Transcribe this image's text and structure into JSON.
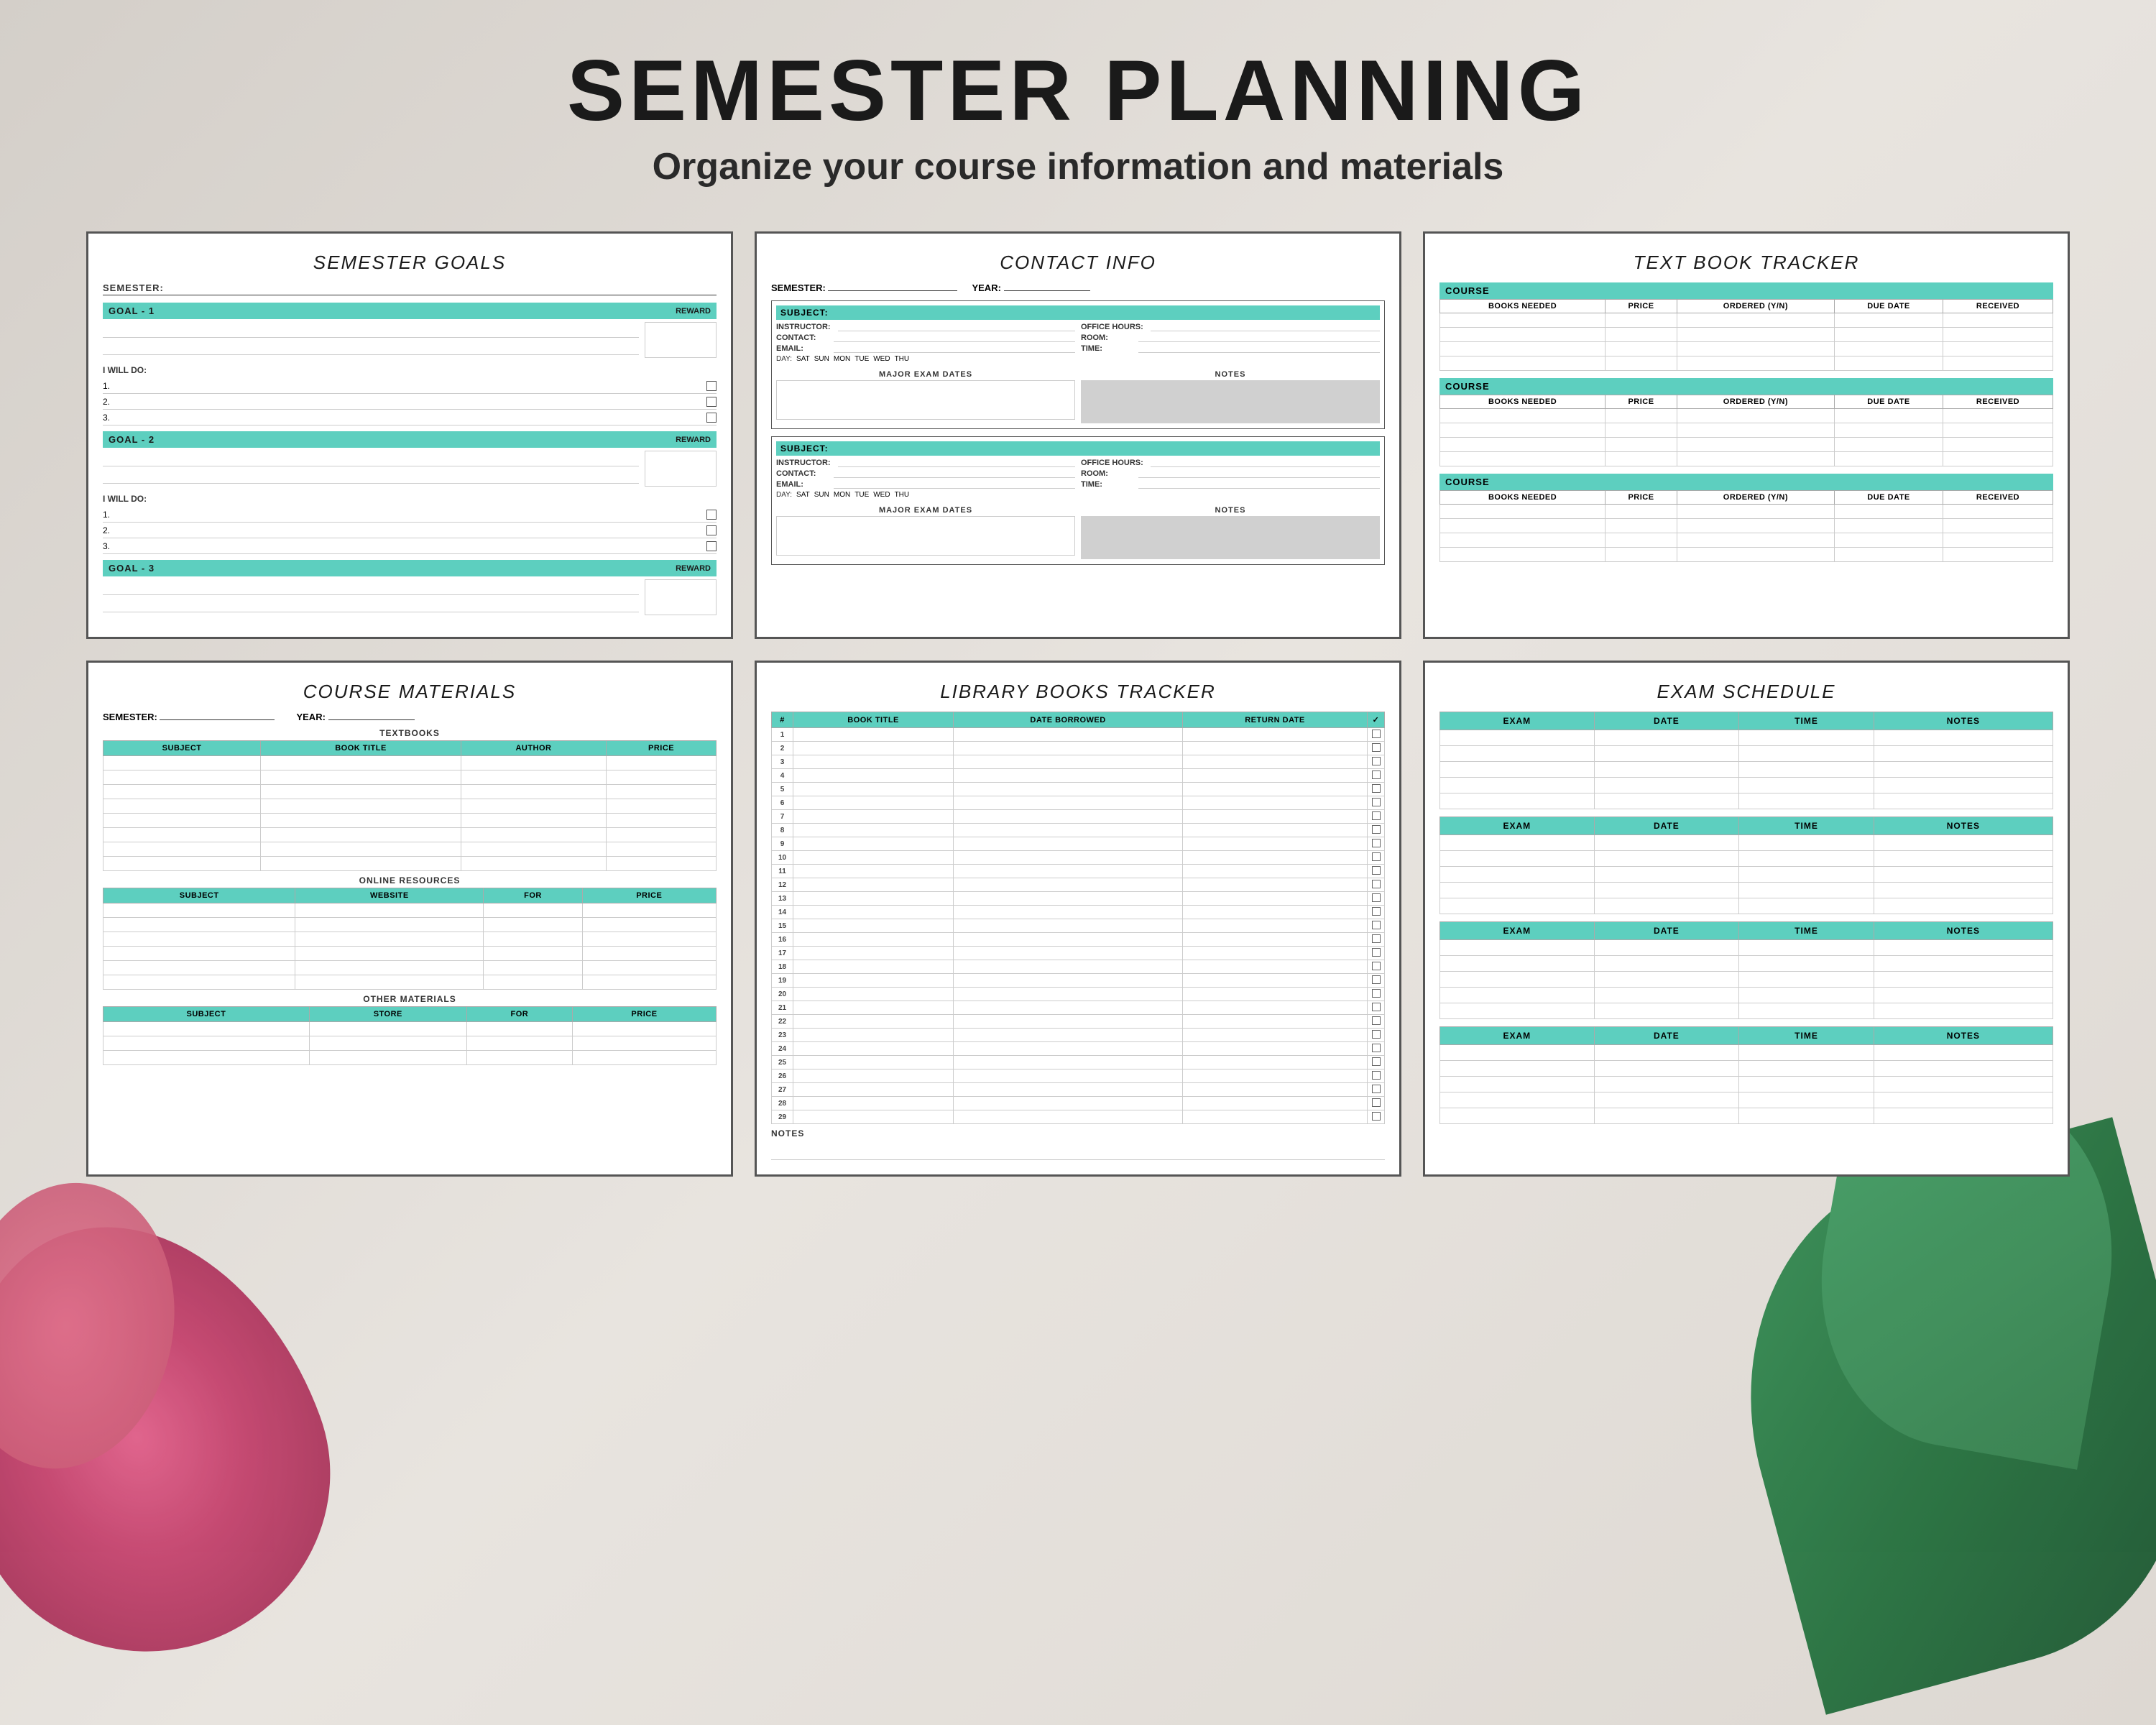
{
  "page": {
    "title": "SEMESTER PLANNING",
    "subtitle": "Organize your course information and materials",
    "background_color": "#e8e4df"
  },
  "cards": {
    "semester_goals": {
      "title": "SEMESTER",
      "title_italic": "GOALS",
      "semester_label": "SEMESTER:",
      "goals": [
        {
          "label": "GOAL - 1",
          "reward": "REWARD"
        },
        {
          "label": "GOAL - 2",
          "reward": "REWARD"
        },
        {
          "label": "GOAL - 3",
          "reward": "REWARD"
        }
      ],
      "will_do_label": "I WILL DO:",
      "items": [
        "1.",
        "2.",
        "3."
      ]
    },
    "contact_info": {
      "title": "CONTACT",
      "title_italic": "INFO",
      "semester_label": "SEMESTER:",
      "year_label": "YEAR:",
      "fields": [
        "SUBJECT:",
        "INSTRUCTOR:",
        "CONTACT:",
        "EMAIL:"
      ],
      "right_fields": [
        "OFFICE HOURS:",
        "ROOM:",
        "TIME:"
      ],
      "days": [
        "DAY:",
        "SAT",
        "SUN",
        "MON",
        "TUE",
        "WED",
        "THU"
      ],
      "exam_dates_label": "MAJOR EXAM DATES",
      "notes_label": "NOTES"
    },
    "textbook_tracker": {
      "title": "TEXT BOOK",
      "title_italic": "TRACKER",
      "course_label": "COURSE",
      "columns": [
        "BOOKS NEEDED",
        "PRICE",
        "ORDERED (Y/N)",
        "DUE DATE",
        "RECEIVED"
      ],
      "rows": 4,
      "sections": 3
    },
    "course_materials": {
      "title": "COURSE",
      "title_italic": "MATERIALS",
      "semester_label": "SEMESTER:",
      "year_label": "YEAR:",
      "sections": [
        {
          "label": "TEXTBOOKS",
          "columns": [
            "SUBJECT",
            "BOOK TITLE",
            "AUTHOR",
            "PRICE"
          ],
          "rows": 8
        },
        {
          "label": "ONLINE RESOURCES",
          "columns": [
            "SUBJECT",
            "WEBSITE",
            "FOR",
            "PRICE"
          ],
          "rows": 6
        },
        {
          "label": "OTHER MATERIALS",
          "columns": [
            "SUBJECT",
            "STORE",
            "FOR",
            "PRICE"
          ],
          "rows": 3
        }
      ]
    },
    "library_books": {
      "title": "LIBRARY BOOKS",
      "title_italic": "TRACKER",
      "columns": [
        "#",
        "BOOK TITLE",
        "DATE BORROWED",
        "RETURN DATE",
        "✓"
      ],
      "rows": 29,
      "notes_label": "NOTES"
    },
    "exam_schedule": {
      "title": "EXAM",
      "title_italic": "SCHEDULE",
      "columns": [
        "EXAM",
        "DATE",
        "TIME",
        "NOTES"
      ],
      "sections": 4,
      "rows_per_section": 5
    }
  }
}
